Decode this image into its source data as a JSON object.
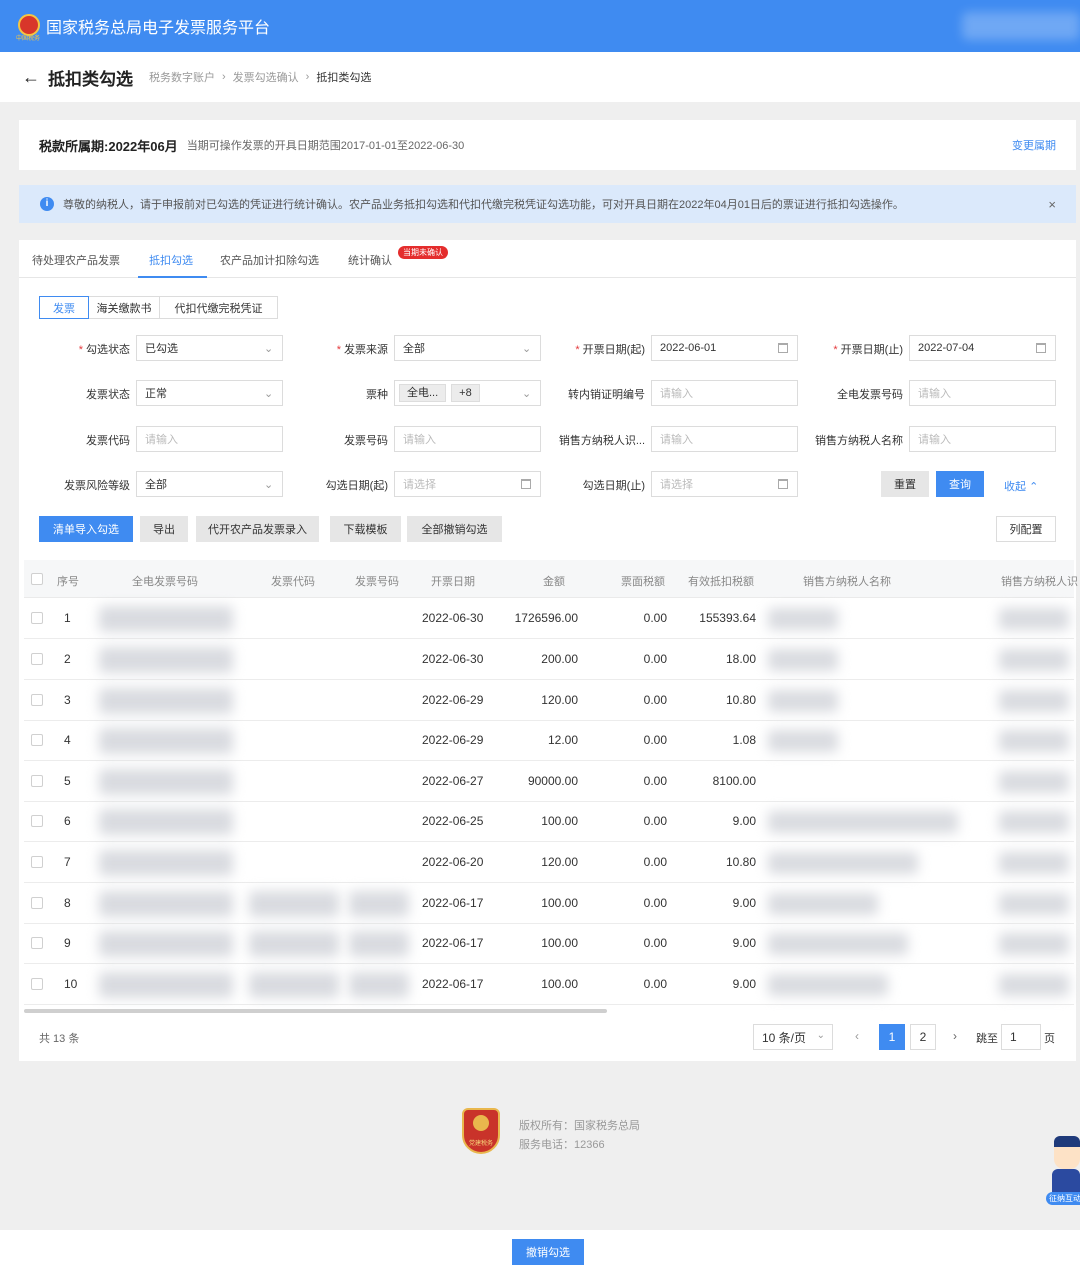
{
  "app": {
    "title": "国家税务总局电子发票服务平台"
  },
  "header": {
    "back_icon": "←",
    "title": "抵扣类勾选",
    "breadcrumb": [
      "税务数字账户",
      "发票勾选确认",
      "抵扣类勾选"
    ]
  },
  "period": {
    "label": "税款所属期:",
    "value": "2022年06月",
    "note": "当期可操作发票的开具日期范围2017-01-01至2022-06-30",
    "change_link": "变更属期"
  },
  "notice": {
    "text": "尊敬的纳税人，请于申报前对已勾选的凭证进行统计确认。农产品业务抵扣勾选和代扣代缴完税凭证勾选功能，可对开具日期在2022年04月01日后的票证进行抵扣勾选操作。",
    "close": "×"
  },
  "tabs": [
    {
      "label": "待处理农产品发票"
    },
    {
      "label": "抵扣勾选"
    },
    {
      "label": "农产品加计扣除勾选"
    },
    {
      "label": "统计确认"
    }
  ],
  "tab_badge": "当期未确认",
  "segments": [
    "发票",
    "海关缴款书",
    "代扣代缴完税凭证"
  ],
  "filters": {
    "select_status": {
      "label": "勾选状态",
      "value": "已勾选"
    },
    "invoice_source": {
      "label": "发票来源",
      "value": "全部"
    },
    "date_start": {
      "label": "开票日期(起)",
      "value": "2022-06-01"
    },
    "date_end": {
      "label": "开票日期(止)",
      "value": "2022-07-04"
    },
    "invoice_status": {
      "label": "发票状态",
      "value": "正常"
    },
    "ticket_type": {
      "label": "票种",
      "chip": "全电...",
      "more": "+8"
    },
    "transfer_no": {
      "label": "转内销证明编号",
      "placeholder": "请输入"
    },
    "einvoice_no": {
      "label": "全电发票号码",
      "placeholder": "请输入"
    },
    "invoice_code": {
      "label": "发票代码",
      "placeholder": "请输入"
    },
    "invoice_no": {
      "label": "发票号码",
      "placeholder": "请输入"
    },
    "seller_id": {
      "label": "销售方纳税人识...",
      "placeholder": "请输入"
    },
    "seller_name": {
      "label": "销售方纳税人名称",
      "placeholder": "请输入"
    },
    "risk_level": {
      "label": "发票风险等级",
      "value": "全部"
    },
    "select_date_start": {
      "label": "勾选日期(起)",
      "placeholder": "请选择"
    },
    "select_date_end": {
      "label": "勾选日期(止)",
      "placeholder": "请选择"
    },
    "reset": "重置",
    "query": "查询",
    "collapse": "收起"
  },
  "toolbar": {
    "import": "清单导入勾选",
    "export": "导出",
    "agri_entry": "代开农产品发票录入",
    "template": "下载模板",
    "cancel_all": "全部撤销勾选",
    "columns": "列配置"
  },
  "table": {
    "columns": [
      "序号",
      "全电发票号码",
      "发票代码",
      "发票号码",
      "开票日期",
      "金额",
      "票面税额",
      "有效抵扣税额",
      "销售方纳税人名称",
      "销售方纳税人识"
    ],
    "rows": [
      {
        "no": "1",
        "date": "2022-06-30",
        "amount": "1726596.00",
        "tax": "0.00",
        "deduct": "155393.64"
      },
      {
        "no": "2",
        "date": "2022-06-30",
        "amount": "200.00",
        "tax": "0.00",
        "deduct": "18.00"
      },
      {
        "no": "3",
        "date": "2022-06-29",
        "amount": "120.00",
        "tax": "0.00",
        "deduct": "10.80"
      },
      {
        "no": "4",
        "date": "2022-06-29",
        "amount": "12.00",
        "tax": "0.00",
        "deduct": "1.08"
      },
      {
        "no": "5",
        "date": "2022-06-27",
        "amount": "90000.00",
        "tax": "0.00",
        "deduct": "8100.00"
      },
      {
        "no": "6",
        "date": "2022-06-25",
        "amount": "100.00",
        "tax": "0.00",
        "deduct": "9.00"
      },
      {
        "no": "7",
        "date": "2022-06-20",
        "amount": "120.00",
        "tax": "0.00",
        "deduct": "10.80"
      },
      {
        "no": "8",
        "date": "2022-06-17",
        "amount": "100.00",
        "tax": "0.00",
        "deduct": "9.00"
      },
      {
        "no": "9",
        "date": "2022-06-17",
        "amount": "100.00",
        "tax": "0.00",
        "deduct": "9.00"
      },
      {
        "no": "10",
        "date": "2022-06-17",
        "amount": "100.00",
        "tax": "0.00",
        "deduct": "9.00"
      }
    ]
  },
  "pagination": {
    "total": "共 13 条",
    "page_size": "10 条/页",
    "prev": "‹",
    "pages": [
      "1",
      "2"
    ],
    "next": "›",
    "jump_label": "跳至",
    "jump_value": "1",
    "page_unit": "页"
  },
  "footer": {
    "logo_text": "党建税务",
    "copyright": "版权所有：国家税务总局",
    "phone": "服务电话：12366"
  },
  "mascot": {
    "label": "征纳互动"
  },
  "bottom": {
    "cancel_select": "撤销勾选"
  }
}
